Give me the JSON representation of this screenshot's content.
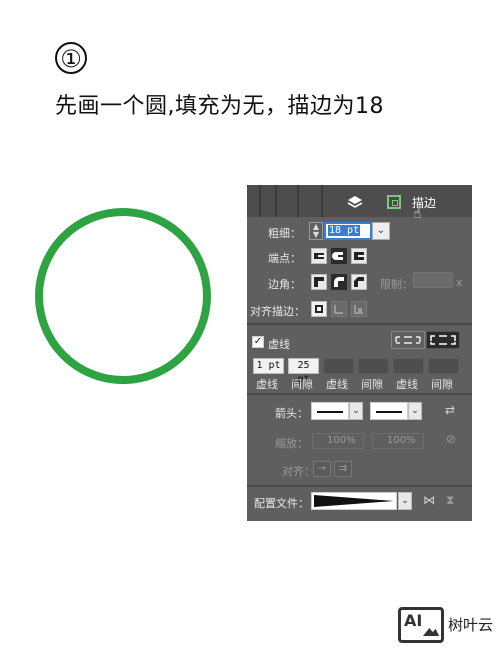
{
  "step_number": "①",
  "instruction": "先画一个圆,填充为无，描边为18",
  "circle": {
    "stroke_color": "#2da342",
    "fill": "none"
  },
  "panel": {
    "tab_title": "描边",
    "weight_label": "粗细：",
    "weight_value": "18 pt",
    "cap_label": "端点：",
    "corner_label": "边角：",
    "miter_label": "限制：",
    "miter_suffix": "x",
    "align_label": "对齐描边：",
    "dashed_label": "虚线",
    "dashed_checked": true,
    "dash_values": [
      "1 pt",
      "25 pt",
      "",
      "",
      "",
      ""
    ],
    "dash_labels": [
      "虚线",
      "间隙",
      "虚线",
      "间隙",
      "虚线",
      "间隙"
    ],
    "arrow_label": "箭头：",
    "scale_label": "缩放：",
    "scale_values": [
      "100%",
      "100%"
    ],
    "arrow_align_label": "对齐：",
    "profile_label": "配置文件："
  },
  "brand": {
    "logo_text": "AI",
    "name": "树叶云"
  }
}
